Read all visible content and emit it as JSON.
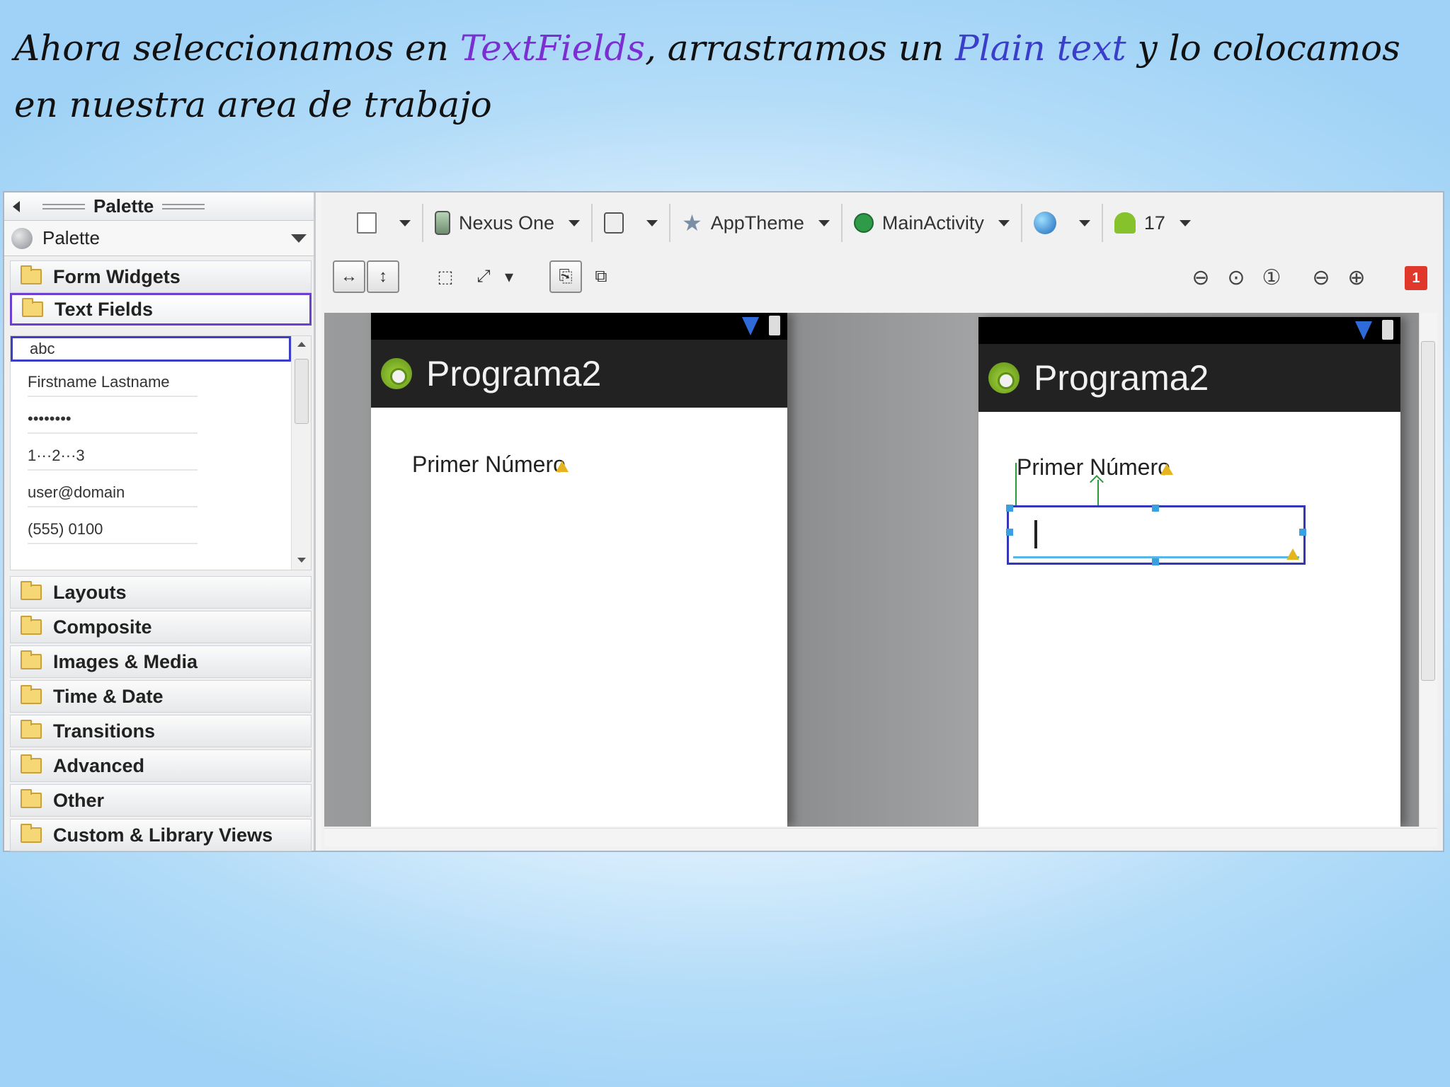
{
  "caption": {
    "part1": "Ahora seleccionamos en ",
    "highlight1": "TextFields",
    "part2": ", arrastramos un ",
    "highlight2": "Plain text",
    "part3": " y lo colocamos en nuestra area de trabajo"
  },
  "palette": {
    "header": "Palette",
    "selector": "Palette",
    "categories": [
      {
        "label": "Form Widgets"
      },
      {
        "label": "Text Fields",
        "selected": true
      },
      {
        "label": "Layouts"
      },
      {
        "label": "Composite"
      },
      {
        "label": "Images & Media"
      },
      {
        "label": "Time & Date"
      },
      {
        "label": "Transitions"
      },
      {
        "label": "Advanced"
      },
      {
        "label": "Other"
      },
      {
        "label": "Custom & Library Views"
      }
    ],
    "text_field_items": [
      "abc",
      "Firstname Lastname",
      "••••••••",
      "1···2···3",
      "user@domain",
      "(555) 0100"
    ]
  },
  "toolbar": {
    "device": "Nexus One",
    "theme": "AppTheme",
    "activity": "MainActivity",
    "api_level": "17",
    "error_count": "1"
  },
  "preview": {
    "app_title": "Programa2",
    "label": "Primer Número"
  },
  "colors": {
    "selection_outline": "#6d3fd0",
    "textbox_outline": "#3636b8",
    "highlight_textfields": "#7a2fd0",
    "highlight_plaintext": "#3a3ec8"
  },
  "icons": [
    "triangle-left-icon",
    "palette-globe-icon",
    "chevron-down-icon",
    "folder-icon",
    "document-icon",
    "phone-icon",
    "rotate-icon",
    "star-icon",
    "run-icon",
    "globe-icon",
    "android-icon",
    "zoom-icon",
    "warning-icon",
    "signal-icon",
    "battery-icon",
    "arrow-right-icon"
  ]
}
